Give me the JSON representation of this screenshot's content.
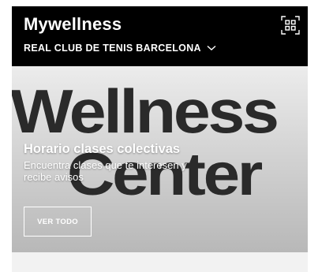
{
  "header": {
    "app_title": "Mywellness",
    "club_name": "REAL CLUB DE TENIS BARCELONA",
    "qr_icon": "qr-code-icon",
    "chevron_icon": "chevron-down-icon"
  },
  "hero": {
    "background_text_line1": "Wellness",
    "background_text_line2": "Center",
    "title": "Horario clases colectivas",
    "subtitle": "Encuentra clases que te interesen y recibe avisos",
    "button_label": "VER TODO"
  },
  "colors": {
    "header_bg": "#000000",
    "header_text": "#ffffff",
    "page_bg": "#f2f2f2"
  }
}
